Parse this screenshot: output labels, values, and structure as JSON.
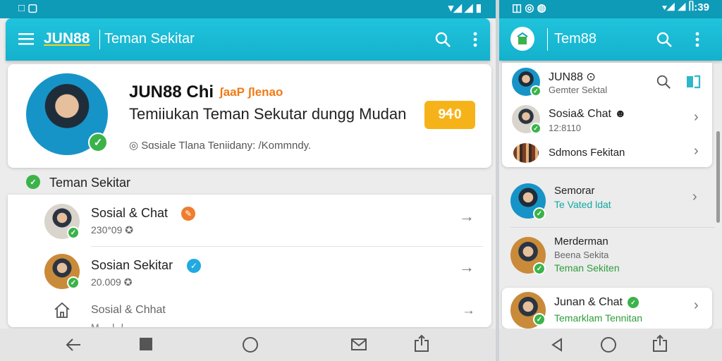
{
  "left": {
    "status_left": "□ ▢",
    "status_right": "▾◢ ◢ ▮",
    "app_logo": "JUN88",
    "app_title": "Teman Sekitar",
    "menu_icon": "menu-icon",
    "search_icon": "search-icon",
    "more_icon": "more-vert-icon",
    "profile": {
      "title": "JUN88 Chi",
      "title_badge": "ʃaaP ʃlenao",
      "subtitle": "Temiiukan Teman Sekutar dungg Mudan",
      "button_label": "9Ꮞ0",
      "footnote": "◎ Sɑsiale Tlana Teniidany: /Kommndy."
    },
    "section_label": "Teman Sekitar",
    "rows": [
      {
        "title": "Sosial & Chat",
        "sub": "230ᐤ09 ✪",
        "badge": "✎",
        "badge_color": "#ef7d2d"
      },
      {
        "title": "Sosian Sekitar",
        "sub": "20.009 ✪",
        "badge": "✓",
        "badge_color": "#21a9e1"
      }
    ],
    "row3_title": "Sosial & Chhat",
    "row3_sub": "M····l··l··",
    "nav": {
      "back": "back-icon",
      "recents": "recents-icon",
      "home": "home-icon",
      "mail": "mail-icon",
      "share": "share-icon"
    },
    "accent": "#14b1cd",
    "green": "#3bb34a",
    "orange": "#f6b319"
  },
  "right": {
    "status_left": "◫ ◎ ◍",
    "status_right": "▾◢ ◢ ᥥ:39",
    "app_title": "Tem88",
    "top_items": [
      {
        "title": "JUN88 ⊙",
        "sub": "Gemter Sektal"
      },
      {
        "title": "Sosia& Chat ☻",
        "sub": "12:8110"
      },
      {
        "title": "Sdmons Fekitan",
        "sub": ""
      }
    ],
    "list_items": [
      {
        "title": "Semorar",
        "sub": "Te Vated ldat",
        "sub2": "",
        "sub_color": "#15a8a0"
      },
      {
        "title": "Merderman",
        "sub": "Beena Sekita",
        "sub2": "Teman Sekiten",
        "sub_color": "#666"
      },
      {
        "title": "Junan & Chat",
        "sub": "Temarklam Tennitan",
        "sub2": "",
        "sub_color": "#2f9c3d"
      }
    ]
  }
}
